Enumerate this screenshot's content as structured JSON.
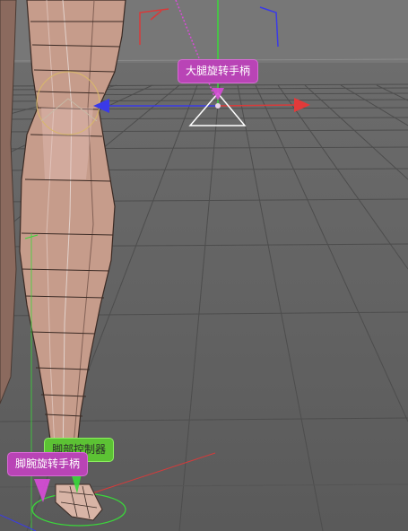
{
  "viewport": {
    "background": "#6b6b6b",
    "grid_color": "#4a4a4a",
    "axis_x_color": "#e23a3a",
    "axis_y_color": "#3adf3a",
    "axis_z_color": "#3a3ae2",
    "mesh_color": "#c99f8e",
    "callout_magenta": "#b944b6",
    "callout_green": "#5cc234"
  },
  "labels": {
    "thigh_rotation_handle": "大腿旋转手柄",
    "foot_controller": "脚部控制器",
    "ankle_rotation_handle": "脚腕旋转手柄"
  },
  "icons": {
    "move_gizmo": "move-gizmo-icon",
    "rotate_ring": "rotate-ring-icon"
  }
}
